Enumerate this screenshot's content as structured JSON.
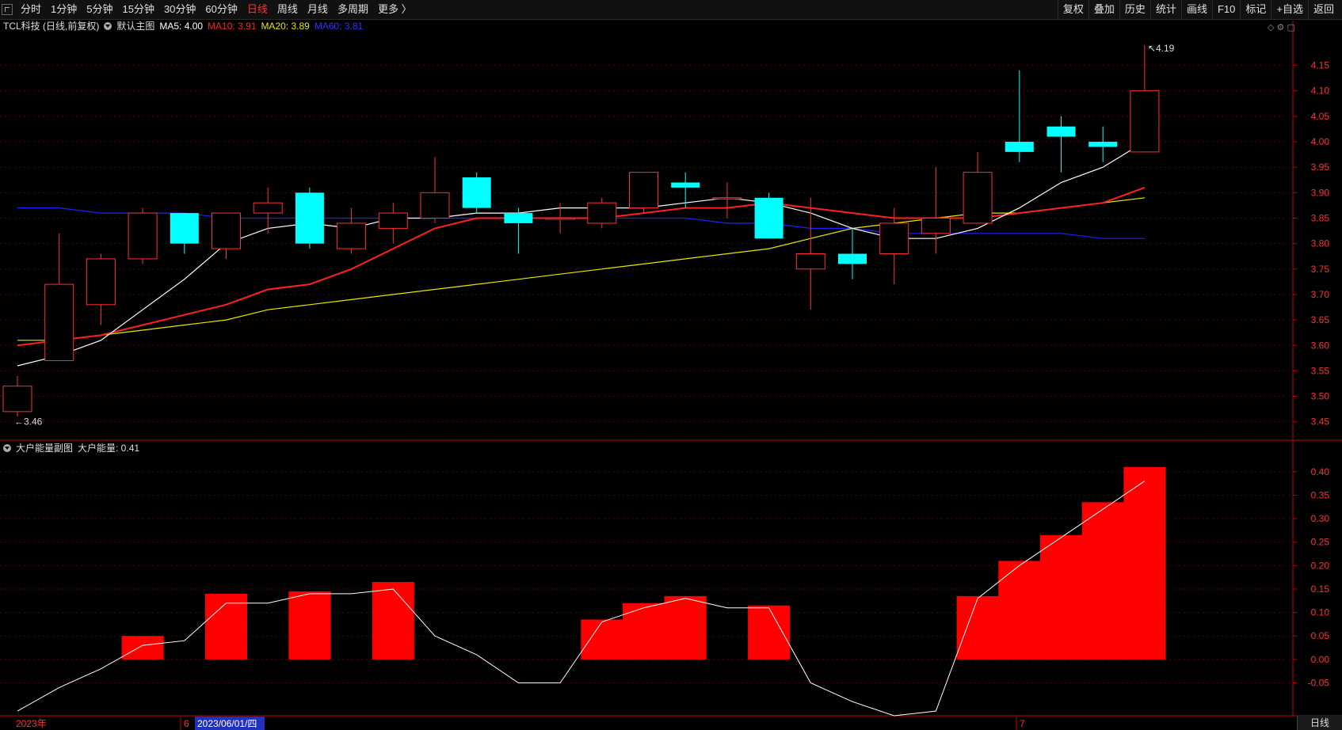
{
  "toolbar": {
    "left": [
      "分时",
      "1分钟",
      "5分钟",
      "15分钟",
      "30分钟",
      "60分钟",
      "日线",
      "周线",
      "月线",
      "多周期",
      "更多 〉"
    ],
    "active": "日线",
    "right": [
      "复权",
      "叠加",
      "历史",
      "统计",
      "画线",
      "F10",
      "标记",
      "+自选",
      "返回"
    ]
  },
  "main_info": {
    "stock": "TCL科技 (日线,前复权)",
    "template": "默认主图",
    "ma5": "MA5: 4.00",
    "ma10": "MA10: 3.91",
    "ma20": "MA20: 3.89",
    "ma60": "MA60: 3.81"
  },
  "sub_info": {
    "name": "大户能量副图",
    "value": "大户能量: 0.41"
  },
  "date_axis": {
    "year": "2023年",
    "m6": "6",
    "cursor": "2023/06/01/四",
    "m7": "7"
  },
  "bottom_tab": "日线",
  "colors": {
    "up": "#ff3030",
    "down": "#00ffff",
    "ma5": "#ffffff",
    "ma10": "#ff2020",
    "ma20": "#e6e600",
    "ma60": "#2020ff",
    "energy_bar": "#ff0000",
    "energy_line": "#ffffff"
  },
  "chart_data": [
    {
      "type": "candlestick",
      "title": "TCL科技 (日线,前复权)",
      "ylim": [
        3.42,
        4.21
      ],
      "yticks": [
        3.45,
        3.5,
        3.55,
        3.6,
        3.65,
        3.7,
        3.75,
        3.8,
        3.85,
        3.9,
        3.95,
        4.0,
        4.05,
        4.1,
        4.15
      ],
      "annotations": [
        {
          "label": "3.46",
          "type": "low"
        },
        {
          "label": "4.19",
          "type": "high"
        }
      ],
      "candles": [
        {
          "o": 3.47,
          "c": 3.52,
          "h": 3.54,
          "l": 3.46
        },
        {
          "o": 3.57,
          "c": 3.72,
          "h": 3.82,
          "l": 3.57
        },
        {
          "o": 3.68,
          "c": 3.77,
          "h": 3.78,
          "l": 3.64
        },
        {
          "o": 3.77,
          "c": 3.86,
          "h": 3.87,
          "l": 3.76
        },
        {
          "o": 3.86,
          "c": 3.8,
          "h": 3.86,
          "l": 3.78
        },
        {
          "o": 3.79,
          "c": 3.86,
          "h": 3.86,
          "l": 3.77
        },
        {
          "o": 3.86,
          "c": 3.88,
          "h": 3.91,
          "l": 3.82
        },
        {
          "o": 3.9,
          "c": 3.8,
          "h": 3.91,
          "l": 3.79
        },
        {
          "o": 3.79,
          "c": 3.84,
          "h": 3.87,
          "l": 3.78
        },
        {
          "o": 3.83,
          "c": 3.86,
          "h": 3.88,
          "l": 3.8
        },
        {
          "o": 3.85,
          "c": 3.9,
          "h": 3.97,
          "l": 3.84
        },
        {
          "o": 3.93,
          "c": 3.87,
          "h": 3.94,
          "l": 3.86
        },
        {
          "o": 3.86,
          "c": 3.84,
          "h": 3.87,
          "l": 3.78
        },
        {
          "o": 3.85,
          "c": 3.85,
          "h": 3.88,
          "l": 3.82
        },
        {
          "o": 3.84,
          "c": 3.88,
          "h": 3.89,
          "l": 3.83
        },
        {
          "o": 3.87,
          "c": 3.94,
          "h": 3.94,
          "l": 3.86
        },
        {
          "o": 3.92,
          "c": 3.91,
          "h": 3.94,
          "l": 3.87
        },
        {
          "o": 3.89,
          "c": 3.89,
          "h": 3.92,
          "l": 3.85
        },
        {
          "o": 3.89,
          "c": 3.81,
          "h": 3.9,
          "l": 3.81
        },
        {
          "o": 3.75,
          "c": 3.78,
          "h": 3.89,
          "l": 3.67
        },
        {
          "o": 3.78,
          "c": 3.76,
          "h": 3.83,
          "l": 3.73
        },
        {
          "o": 3.78,
          "c": 3.84,
          "h": 3.87,
          "l": 3.72
        },
        {
          "o": 3.82,
          "c": 3.85,
          "h": 3.95,
          "l": 3.78
        },
        {
          "o": 3.84,
          "c": 3.94,
          "h": 3.98,
          "l": 3.84
        },
        {
          "o": 4.0,
          "c": 3.98,
          "h": 4.14,
          "l": 3.96
        },
        {
          "o": 4.03,
          "c": 4.01,
          "h": 4.05,
          "l": 3.94
        },
        {
          "o": 4.0,
          "c": 3.99,
          "h": 4.03,
          "l": 3.96
        },
        {
          "o": 3.98,
          "c": 4.1,
          "h": 4.19,
          "l": 3.98
        }
      ],
      "series": [
        {
          "name": "MA5",
          "values": [
            3.56,
            3.58,
            3.61,
            3.67,
            3.73,
            3.8,
            3.83,
            3.84,
            3.83,
            3.85,
            3.85,
            3.86,
            3.86,
            3.87,
            3.87,
            3.87,
            3.88,
            3.89,
            3.88,
            3.86,
            3.83,
            3.81,
            3.81,
            3.83,
            3.87,
            3.92,
            3.95,
            4.0
          ]
        },
        {
          "name": "MA10",
          "values": [
            3.6,
            3.61,
            3.62,
            3.64,
            3.66,
            3.68,
            3.71,
            3.72,
            3.75,
            3.79,
            3.83,
            3.85,
            3.85,
            3.85,
            3.85,
            3.86,
            3.87,
            3.87,
            3.88,
            3.87,
            3.86,
            3.85,
            3.85,
            3.85,
            3.86,
            3.87,
            3.88,
            3.91
          ]
        },
        {
          "name": "MA20",
          "values": [
            3.61,
            3.61,
            3.62,
            3.63,
            3.64,
            3.65,
            3.67,
            3.68,
            3.69,
            3.7,
            3.71,
            3.72,
            3.73,
            3.74,
            3.75,
            3.76,
            3.77,
            3.78,
            3.79,
            3.81,
            3.83,
            3.84,
            3.85,
            3.86,
            3.86,
            3.87,
            3.88,
            3.89
          ]
        },
        {
          "name": "MA60",
          "values": [
            3.87,
            3.87,
            3.86,
            3.86,
            3.86,
            3.85,
            3.85,
            3.85,
            3.85,
            3.85,
            3.85,
            3.85,
            3.85,
            3.85,
            3.85,
            3.85,
            3.85,
            3.84,
            3.84,
            3.83,
            3.83,
            3.82,
            3.82,
            3.82,
            3.82,
            3.82,
            3.81,
            3.81
          ]
        }
      ]
    },
    {
      "type": "bar",
      "title": "大户能量副图",
      "ylim": [
        -0.12,
        0.43
      ],
      "yticks": [
        -0.05,
        0.0,
        0.05,
        0.1,
        0.15,
        0.2,
        0.25,
        0.3,
        0.35,
        0.4
      ],
      "series": [
        {
          "name": "大户能量",
          "values": [
            -0.11,
            -0.06,
            -0.02,
            0.03,
            0.04,
            0.12,
            0.12,
            0.14,
            0.14,
            0.15,
            0.05,
            0.01,
            -0.05,
            -0.05,
            0.08,
            0.11,
            0.13,
            0.11,
            0.11,
            -0.05,
            -0.09,
            -0.12,
            -0.11,
            0.13,
            0.2,
            0.26,
            0.32,
            0.38
          ]
        },
        {
          "name": "bars",
          "values": [
            0,
            0,
            0,
            0.05,
            0,
            0.14,
            0,
            0.145,
            0,
            0.165,
            0,
            0,
            0,
            0,
            0.085,
            0.12,
            0.135,
            0,
            0.115,
            0,
            0,
            0,
            0,
            0.135,
            0.21,
            0.265,
            0.335,
            0.41
          ]
        }
      ]
    }
  ]
}
